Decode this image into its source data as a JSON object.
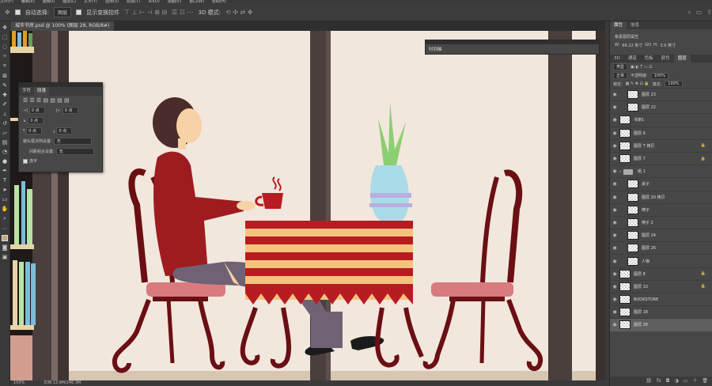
{
  "menu": [
    "文件(F)",
    "编辑(E)",
    "图像(I)",
    "图层(L)",
    "文字(Y)",
    "选择(S)",
    "滤镜(T)",
    "3D(D)",
    "视图(V)",
    "窗口(W)",
    "帮助(H)"
  ],
  "options": {
    "auto_select_label": "自动选择:",
    "auto_select_value": "图层",
    "show_transform_label": "显示变换控件",
    "mode3d_label": "3D 模式:"
  },
  "doc_tab": "城市书房.psd @ 100% (图层 28, RGB/8#)",
  "status": {
    "zoom": "100%",
    "doc": "文档:13.9M/246.3M"
  },
  "paragraph_panel": {
    "tabs": [
      "字符",
      "段落"
    ],
    "indent_left": "0 点",
    "indent_right": "0 点",
    "first_line": "0 点",
    "space_before": "0 点",
    "space_after": "0 点",
    "avoid_label": "避头尾法则设置:",
    "avoid_value": "无",
    "spacing_label": "间距组合设置:",
    "spacing_value": "无",
    "hyphen_label": "连字"
  },
  "timeline_panel": {
    "title": "时间轴"
  },
  "right_panel": {
    "top_tabs": [
      "属性",
      "信息"
    ],
    "prop_title": "像素图层属性",
    "w_label": "W:",
    "w_value": "66.22 英寸",
    "link_label": "GO",
    "h_label": "H:",
    "h_value": "3.9 英寸",
    "layer_tabs": [
      "3D",
      "通道",
      "色板",
      "颜色",
      "图层"
    ],
    "kind_value": "类型",
    "blend_value": "正常",
    "opacity_label": "不透明度:",
    "opacity_value": "100%",
    "lock_label": "锁定:",
    "fill_label": "填充:",
    "fill_value": "100%",
    "layers": [
      {
        "name": "图层 23",
        "indent": true,
        "lock": false,
        "type": "layer"
      },
      {
        "name": "图层 22",
        "indent": true,
        "lock": false,
        "type": "layer"
      },
      {
        "name": "书架1",
        "indent": false,
        "lock": false,
        "type": "layer"
      },
      {
        "name": "图层 6",
        "indent": false,
        "lock": false,
        "type": "layer"
      },
      {
        "name": "图层 7 拷贝",
        "indent": false,
        "lock": true,
        "type": "layer"
      },
      {
        "name": "图层 7",
        "indent": false,
        "lock": true,
        "type": "layer"
      },
      {
        "name": "组 1",
        "indent": false,
        "lock": false,
        "type": "group"
      },
      {
        "name": "桌子",
        "indent": true,
        "lock": false,
        "type": "layer"
      },
      {
        "name": "图层 20 拷贝",
        "indent": true,
        "lock": false,
        "type": "layer"
      },
      {
        "name": "椅子",
        "indent": true,
        "lock": false,
        "type": "layer"
      },
      {
        "name": "椅子 2",
        "indent": true,
        "lock": false,
        "type": "layer"
      },
      {
        "name": "图层 24",
        "indent": true,
        "lock": false,
        "type": "layer"
      },
      {
        "name": "图层 26",
        "indent": true,
        "lock": false,
        "type": "layer"
      },
      {
        "name": "人物",
        "indent": true,
        "lock": false,
        "type": "layer"
      },
      {
        "name": "图层 8",
        "indent": false,
        "lock": true,
        "type": "layer"
      },
      {
        "name": "图层 10",
        "indent": false,
        "lock": true,
        "type": "layer"
      },
      {
        "name": "BOOKSTORE",
        "indent": false,
        "lock": false,
        "type": "layer"
      },
      {
        "name": "图层 18",
        "indent": false,
        "lock": false,
        "type": "layer"
      },
      {
        "name": "图层 28",
        "indent": false,
        "lock": false,
        "type": "layer",
        "selected": true
      }
    ],
    "bottom_icons": [
      "link-icon",
      "fx-icon",
      "mask-icon",
      "adjust-icon",
      "folder-icon",
      "new-layer-icon",
      "trash-icon"
    ]
  }
}
